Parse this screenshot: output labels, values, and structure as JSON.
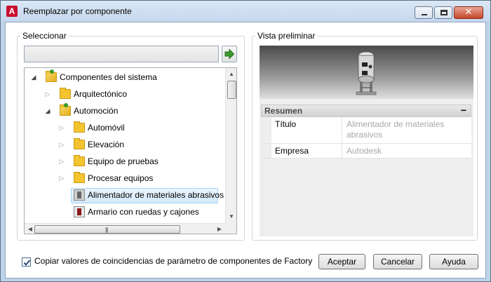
{
  "window": {
    "title": "Reemplazar por componente"
  },
  "select_group": {
    "label": "Seleccionar",
    "input_value": "",
    "tree": [
      {
        "label": "Componentes del sistema",
        "level": 0,
        "expander": "expanded",
        "icon": "folder-open-icon"
      },
      {
        "label": "Arquitectónico",
        "level": 1,
        "expander": "collapsed",
        "icon": "folder-icon"
      },
      {
        "label": "Automoción",
        "level": 1,
        "expander": "expanded",
        "icon": "folder-open-icon"
      },
      {
        "label": "Automóvil",
        "level": 2,
        "expander": "collapsed",
        "icon": "folder-icon"
      },
      {
        "label": "Elevación",
        "level": 2,
        "expander": "collapsed",
        "icon": "folder-icon"
      },
      {
        "label": "Equipo de pruebas",
        "level": 2,
        "expander": "collapsed",
        "icon": "folder-icon"
      },
      {
        "label": "Procesar equipos",
        "level": 2,
        "expander": "collapsed",
        "icon": "folder-icon"
      },
      {
        "label": "Alimentador de materiales abrasivos",
        "level": 2,
        "expander": "none",
        "icon": "component-icon",
        "selected": true
      },
      {
        "label": "Armario con ruedas y cajones",
        "level": 2,
        "expander": "none",
        "icon": "cabinet-component-icon"
      }
    ]
  },
  "preview_group": {
    "label": "Vista preliminar",
    "summary": {
      "header": "Resumen",
      "collapse_glyph": "−",
      "rows": [
        {
          "name": "Título",
          "value": "Alimentador de materiales abrasivos"
        },
        {
          "name": "Empresa",
          "value": "Autodesk"
        }
      ]
    }
  },
  "footer": {
    "checkbox_label": "Copiar valores de coincidencias de parámetro de componentes de Factory",
    "checkbox_checked": true,
    "buttons": {
      "ok": "Aceptar",
      "cancel": "Cancelar",
      "help": "Ayuda"
    }
  },
  "colors": {
    "title_bar": "#c4d8ee",
    "selection": "#d4e9fb",
    "folder": "#f4c430",
    "app_icon": "#c8102e"
  }
}
